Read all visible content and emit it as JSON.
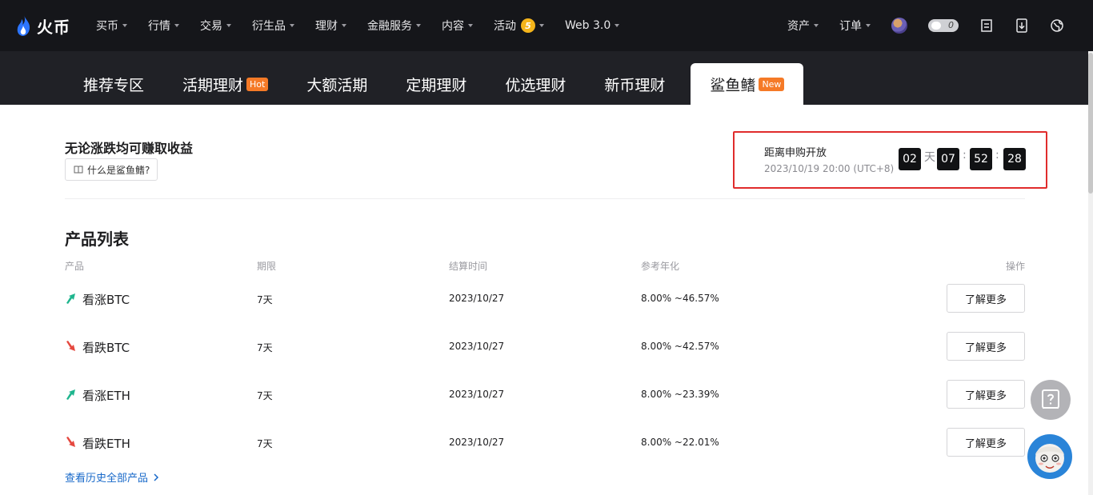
{
  "brand": {
    "name": "火币"
  },
  "nav": {
    "menu": [
      {
        "label": "买币",
        "caret": true
      },
      {
        "label": "行情",
        "caret": true
      },
      {
        "label": "交易",
        "caret": true
      },
      {
        "label": "衍生品",
        "caret": true
      },
      {
        "label": "理财",
        "caret": true
      },
      {
        "label": "金融服务",
        "caret": true
      },
      {
        "label": "内容",
        "caret": true
      },
      {
        "label": "活动",
        "caret": true,
        "badge": "5"
      },
      {
        "label": "Web 3.0",
        "caret": true
      }
    ],
    "assets_label": "资产",
    "orders_label": "订单",
    "toggle_value": "0",
    "icons": [
      "avatar",
      "mode-toggle",
      "notes-icon",
      "download-icon",
      "globe-icon"
    ]
  },
  "tabs": [
    {
      "label": "推荐专区",
      "tag": ""
    },
    {
      "label": "活期理财",
      "tag": "Hot"
    },
    {
      "label": "大额活期",
      "tag": ""
    },
    {
      "label": "定期理财",
      "tag": ""
    },
    {
      "label": "优选理财",
      "tag": ""
    },
    {
      "label": "新币理财",
      "tag": ""
    },
    {
      "label": "鲨鱼鳍",
      "tag": "New",
      "active": true
    }
  ],
  "intro": {
    "headline": "无论涨跌均可赚取收益",
    "what_is_label": "什么是鲨鱼鳍?"
  },
  "countdown": {
    "title": "距离申购开放",
    "datetime": "2023/10/19 20:00 (UTC+8)",
    "days": "02",
    "day_unit": "天",
    "hours": "07",
    "minutes": "52",
    "seconds": "28",
    "sep": ":"
  },
  "product_list": {
    "title": "产品列表",
    "headers": {
      "product": "产品",
      "term": "期限",
      "settle": "结算时间",
      "apy": "参考年化",
      "action": "操作"
    },
    "rows": [
      {
        "direction": "up",
        "name": "看涨BTC",
        "term": "7天",
        "settle": "2023/10/27",
        "apy": "8.00% ~46.57%",
        "action": "了解更多"
      },
      {
        "direction": "down",
        "name": "看跌BTC",
        "term": "7天",
        "settle": "2023/10/27",
        "apy": "8.00% ~42.57%",
        "action": "了解更多"
      },
      {
        "direction": "up",
        "name": "看涨ETH",
        "term": "7天",
        "settle": "2023/10/27",
        "apy": "8.00% ~23.39%",
        "action": "了解更多"
      },
      {
        "direction": "down",
        "name": "看跌ETH",
        "term": "7天",
        "settle": "2023/10/27",
        "apy": "8.00% ~22.01%",
        "action": "了解更多"
      }
    ],
    "history_link": "查看历史全部产品"
  },
  "colors": {
    "up": "#1fb58e",
    "down": "#e5483f",
    "accent_red": "#e02c2c",
    "link": "#1768c9"
  }
}
